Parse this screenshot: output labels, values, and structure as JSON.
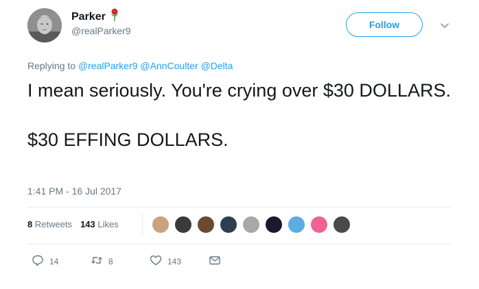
{
  "user": {
    "display_name": "Parker",
    "handle": "@realParker9",
    "name_emoji": "rose-icon"
  },
  "follow_label": "Follow",
  "reply_context": {
    "prefix": "Replying to",
    "mentions": [
      "@realParker9",
      "@AnnCoulter",
      "@Delta"
    ]
  },
  "text": {
    "line1": "I mean seriously. You're crying over $30 DOLLARS.",
    "line2": "$30 EFFING DOLLARS."
  },
  "timestamp": "1:41 PM - 16 Jul 2017",
  "stats": {
    "retweets_count": "8",
    "retweets_label": "Retweets",
    "likes_count": "143",
    "likes_label": "Likes"
  },
  "liker_avatars": [
    {
      "name": "liker-avatar-1",
      "color": "#c9a27e"
    },
    {
      "name": "liker-avatar-2",
      "color": "#3a3a3a"
    },
    {
      "name": "liker-avatar-3",
      "color": "#6b4a2f"
    },
    {
      "name": "liker-avatar-4",
      "color": "#2c3e50"
    },
    {
      "name": "liker-avatar-5",
      "color": "#a8a8a8"
    },
    {
      "name": "liker-avatar-6",
      "color": "#1a1a2e"
    },
    {
      "name": "liker-avatar-7",
      "color": "#5dade2"
    },
    {
      "name": "liker-avatar-8",
      "color": "#f06292"
    },
    {
      "name": "liker-avatar-9",
      "color": "#4a4a4a"
    }
  ],
  "actions": {
    "reply_count": "14",
    "retweet_count": "8",
    "like_count": "143"
  },
  "colors": {
    "accent": "#1da1f2",
    "secondary_text": "#657786",
    "primary_text": "#14171a"
  }
}
